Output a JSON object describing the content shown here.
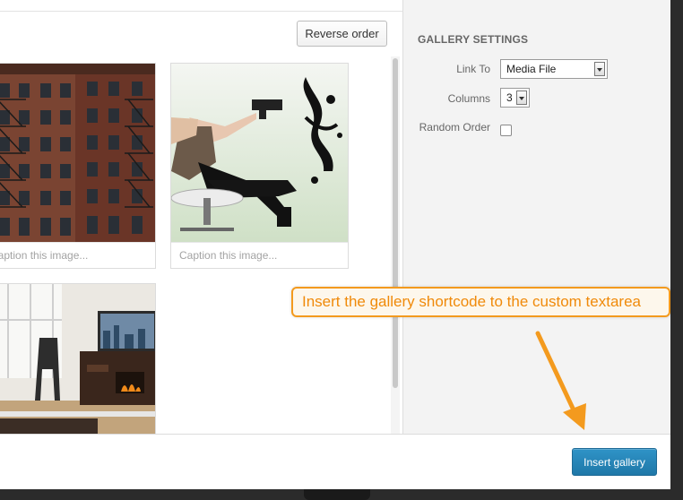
{
  "toolbar": {
    "reverse_order_label": "Reverse order"
  },
  "gallery": {
    "items": [
      {
        "caption_placeholder": "Caption this image..."
      },
      {
        "caption_placeholder": "Caption this image..."
      },
      {
        "caption_placeholder": ""
      }
    ]
  },
  "settings": {
    "title": "GALLERY SETTINGS",
    "link_to": {
      "label": "Link To",
      "value": "Media File"
    },
    "columns": {
      "label": "Columns",
      "value": "3"
    },
    "random_order": {
      "label": "Random Order",
      "checked": false
    }
  },
  "footer": {
    "insert_label": "Insert gallery"
  },
  "annotation": {
    "text": "Insert the gallery shortcode to the custom textarea",
    "color": "#f39a1e"
  },
  "colors": {
    "primary_button": "#2684b8",
    "sidebar_bg": "#f3f3f3"
  }
}
